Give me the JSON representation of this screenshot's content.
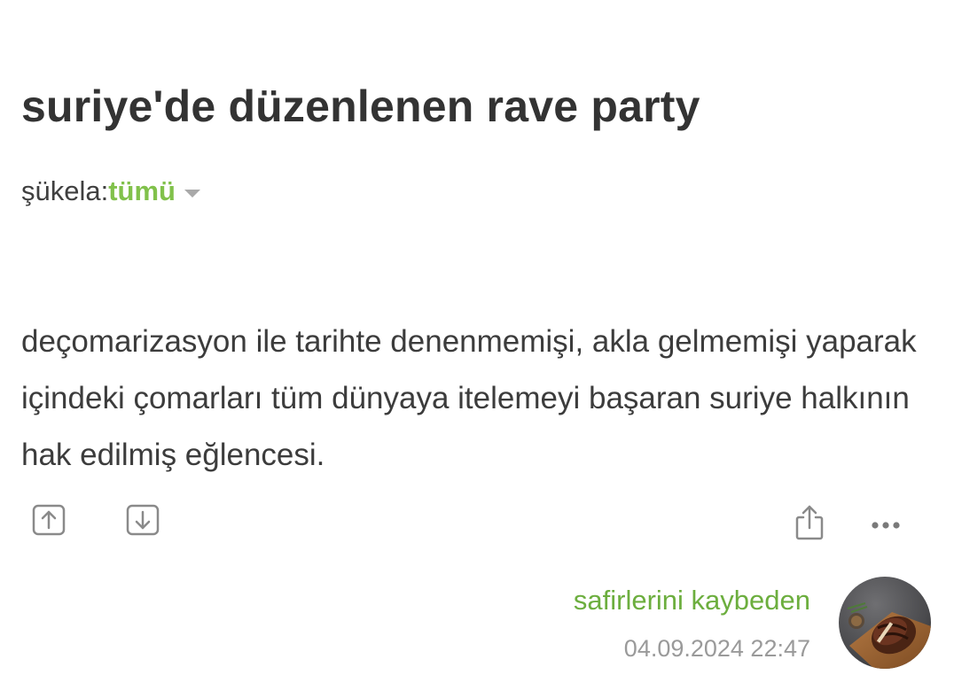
{
  "topic": {
    "title": "suriye'de düzenlenen rave party"
  },
  "filter": {
    "label": "şükela:",
    "value": "tümü",
    "caret_icon": "caret-down-icon"
  },
  "entry": {
    "text": "deçomarizasyon ile tarihte denenmemişi, akla gelmemişi yaparak içindeki çomarları tüm dünyaya itelemeyi başaran suriye halkının hak edilmiş eğlencesi.",
    "author": "safirlerini kaybeden",
    "date": "04.09.2024 22:47",
    "avatar_icon": "avatar-steak-image"
  },
  "actions": {
    "upvote_icon": "upvote-icon",
    "downvote_icon": "downvote-icon",
    "share_icon": "share-icon",
    "more_icon": "more-icon"
  },
  "colors": {
    "accent_green": "#81c14b",
    "author_green": "#6cae3e",
    "text": "#3c3c3c",
    "muted": "#9a9a9a",
    "icon": "#8a8a8a"
  }
}
